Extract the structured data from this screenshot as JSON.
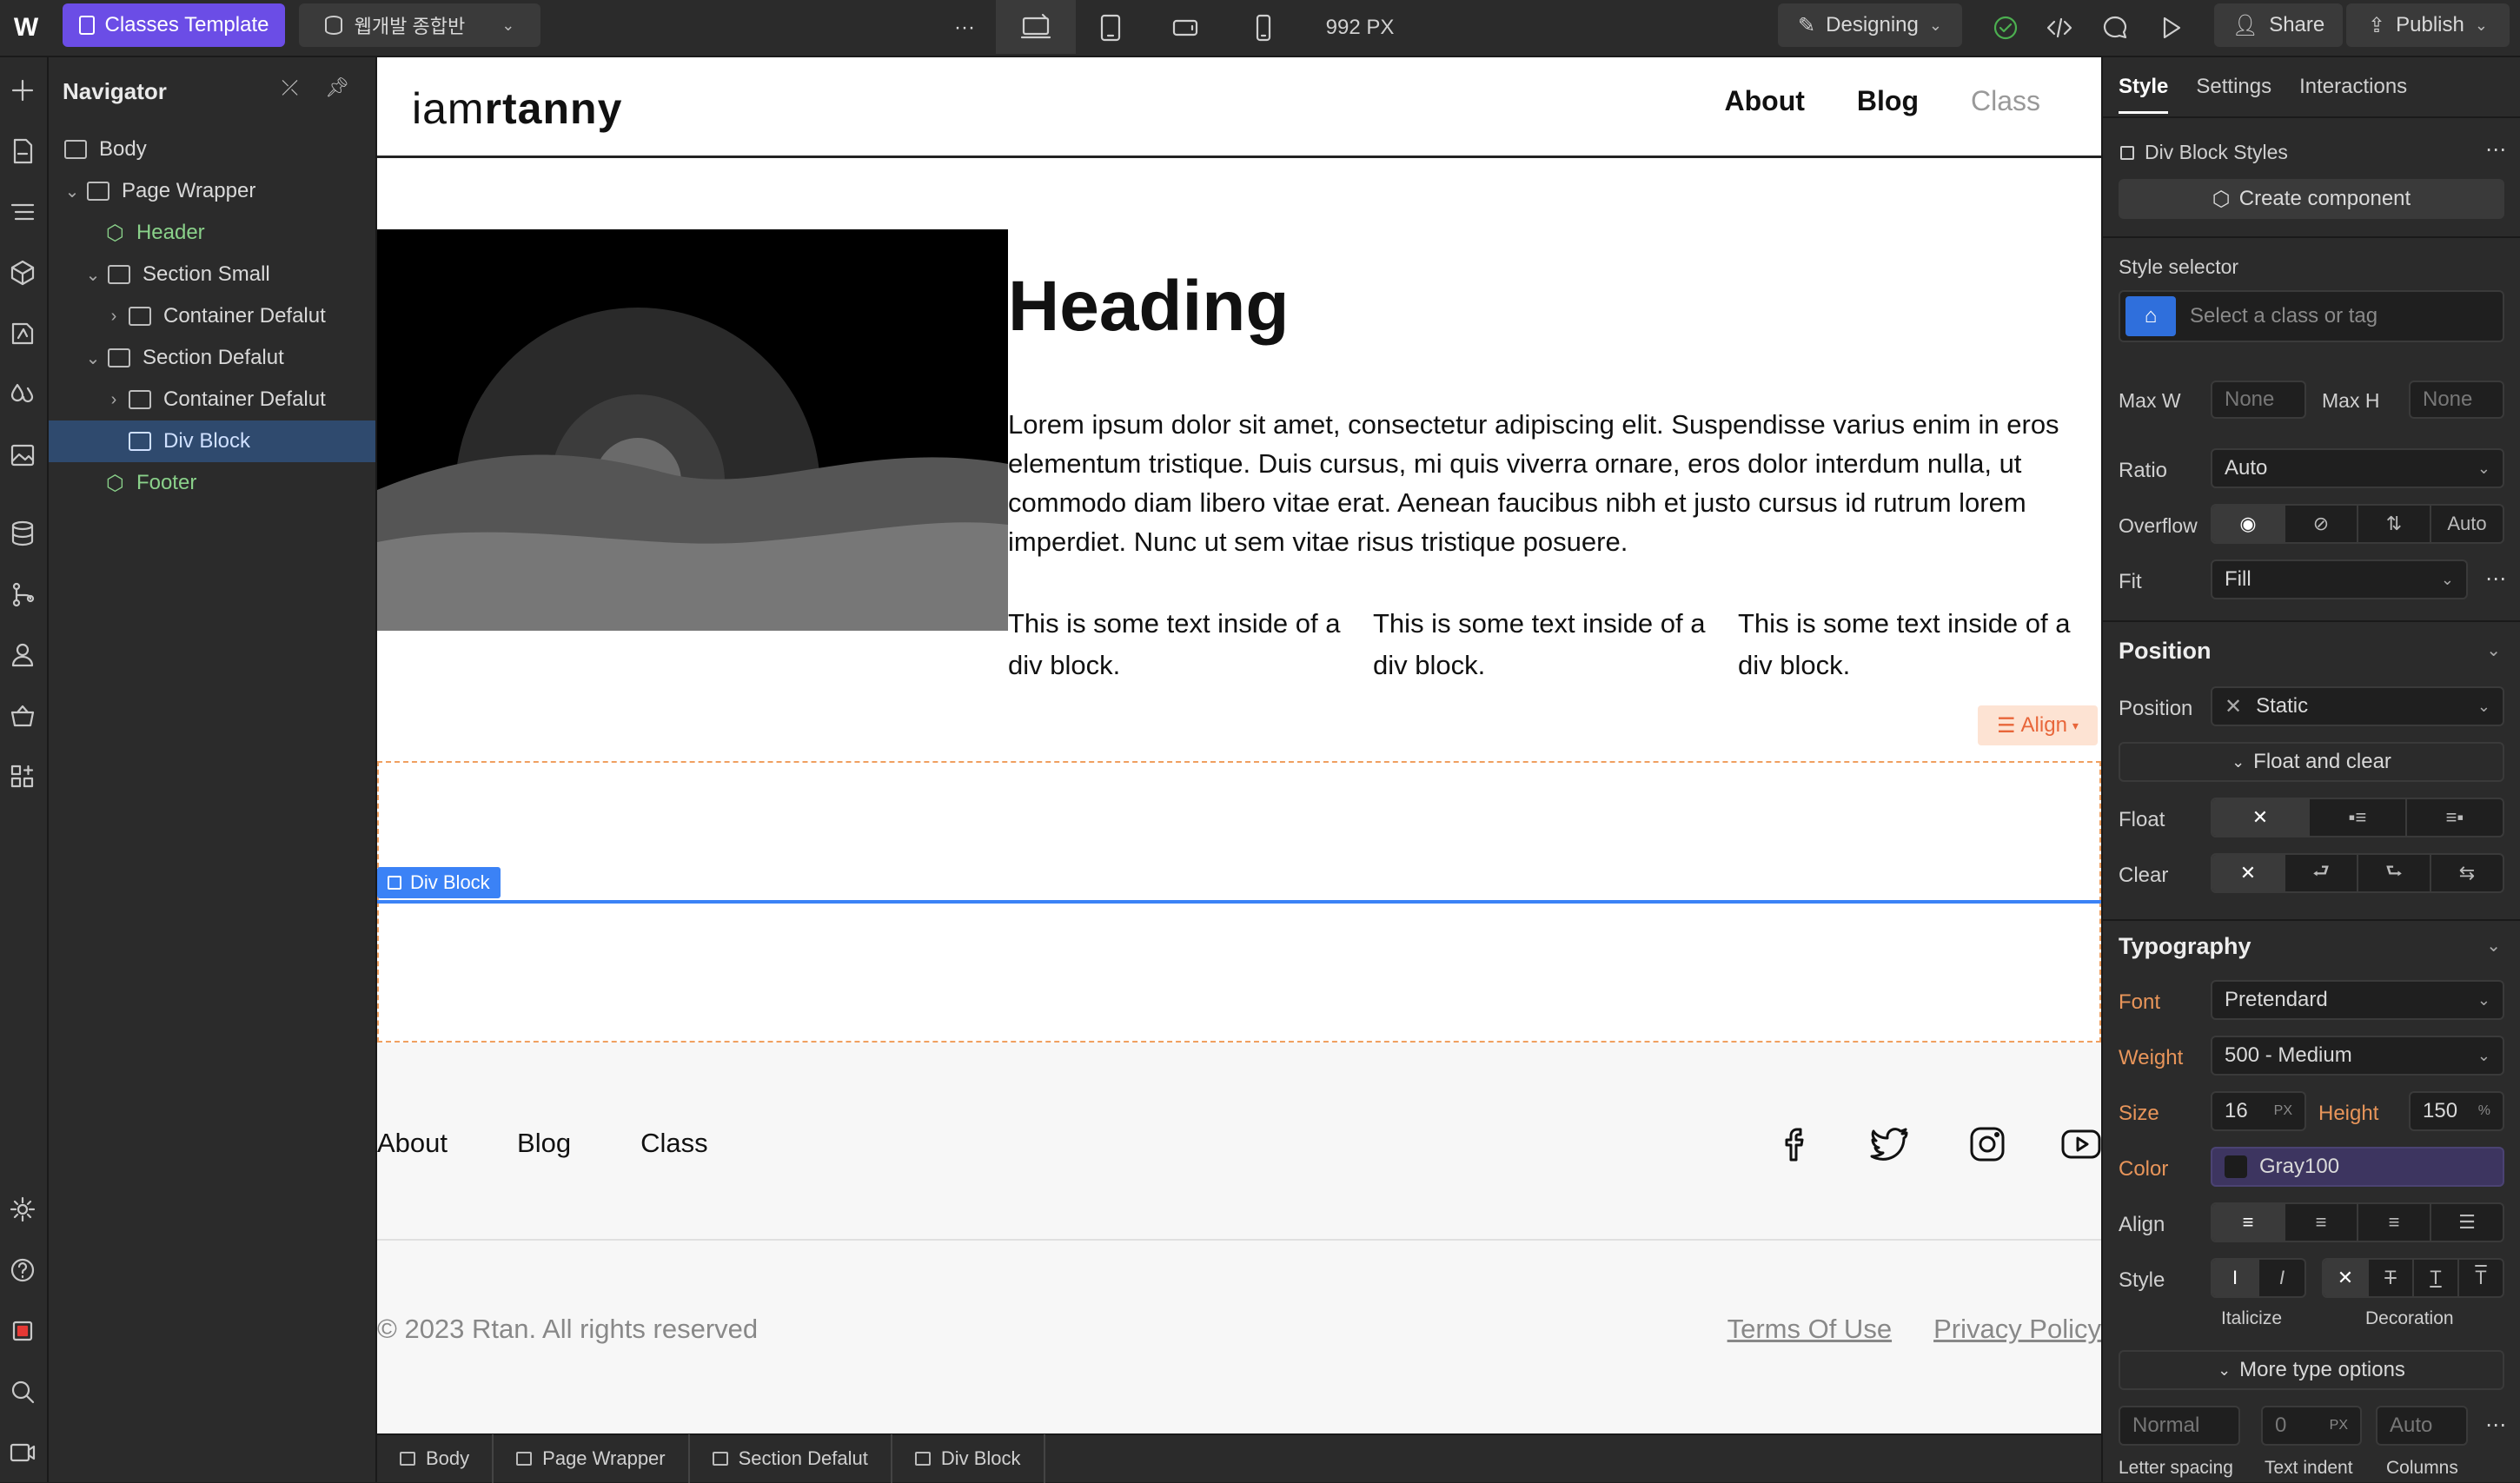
{
  "toolbar": {
    "template_label": "Classes Template",
    "project_label": "웹개발 종합반",
    "more_label": "···",
    "width_readout": "992 PX",
    "mode_label": "Designing",
    "share_label": "Share",
    "publish_label": "Publish"
  },
  "navigator": {
    "title": "Navigator",
    "items": [
      {
        "label": "Body"
      },
      {
        "label": "Page Wrapper"
      },
      {
        "label": "Header"
      },
      {
        "label": "Section Small"
      },
      {
        "label": "Container Defalut"
      },
      {
        "label": "Section Defalut"
      },
      {
        "label": "Container Defalut"
      },
      {
        "label": "Div Block"
      },
      {
        "label": "Footer"
      }
    ]
  },
  "site": {
    "logo_light": "iam",
    "logo_bold": "rtanny",
    "nav": [
      "About",
      "Blog",
      "Class"
    ],
    "heading": "Heading",
    "paragraph": "Lorem ipsum dolor sit amet, consectetur adipiscing elit. Suspendisse varius enim in eros elementum tristique. Duis cursus, mi quis viverra ornare, eros dolor interdum nulla, ut commodo diam libero vitae erat. Aenean faucibus nibh et justo cursus id rutrum lorem imperdiet. Nunc ut sem vitae risus tristique posuere.",
    "div_text": "This is some text inside of a div block.",
    "align_label": "Align",
    "selected_label": "Div Block",
    "footer_links": [
      "About",
      "Blog",
      "Class"
    ],
    "copyright": "© 2023 Rtan. All rights reserved",
    "terms": "Terms Of Use",
    "privacy": "Privacy Policy"
  },
  "breadcrumbs": [
    "Body",
    "Page Wrapper",
    "Section Defalut",
    "Div Block"
  ],
  "panel": {
    "tabs": [
      "Style",
      "Settings",
      "Interactions"
    ],
    "styles_title": "Div Block Styles",
    "create_component": "Create component",
    "style_selector_label": "Style selector",
    "style_selector_placeholder": "Select a class or tag",
    "max_w_label": "Max W",
    "max_w_value": "None",
    "max_h_label": "Max H",
    "max_h_value": "None",
    "ratio_label": "Ratio",
    "ratio_value": "Auto",
    "overflow_label": "Overflow",
    "overflow_auto": "Auto",
    "fit_label": "Fit",
    "fit_value": "Fill",
    "position_section": "Position",
    "position_label": "Position",
    "position_value": "Static",
    "float_clear": "Float and clear",
    "float_label": "Float",
    "clear_label": "Clear",
    "typography_section": "Typography",
    "font_label": "Font",
    "font_value": "Pretendard",
    "weight_label": "Weight",
    "weight_value": "500 - Medium",
    "size_label": "Size",
    "size_value": "16",
    "size_unit": "PX",
    "height_label": "Height",
    "height_value": "150",
    "height_unit": "%",
    "color_label": "Color",
    "color_value": "Gray100",
    "align_label": "Align",
    "style_label": "Style",
    "italicize_label": "Italicize",
    "decoration_label": "Decoration",
    "more_type": "More type options",
    "letter_spacing_value": "Normal",
    "text_indent_value": "0",
    "text_indent_unit": "PX",
    "columns_value": "Auto",
    "letter_spacing_label": "Letter spacing",
    "text_indent_label": "Text indent",
    "columns_label": "Columns"
  },
  "colors": {
    "accent": "#3b82f6",
    "template_purple": "#6b4de6",
    "orange": "#e8955a"
  }
}
